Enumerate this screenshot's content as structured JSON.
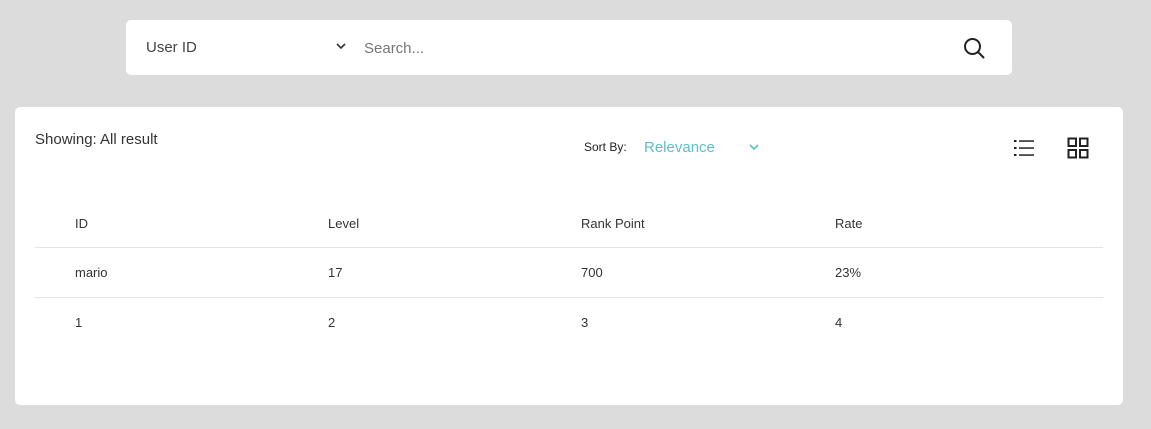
{
  "search": {
    "filter_label": "User ID",
    "placeholder": "Search...",
    "value": ""
  },
  "results": {
    "showing_label": "Showing: All result",
    "sort_label": "Sort By:",
    "sort_value": "Relevance",
    "columns": [
      "ID",
      "Level",
      "Rank Point",
      "Rate"
    ],
    "rows": [
      [
        "mario",
        "17",
        "700",
        "23%"
      ],
      [
        "1",
        "2",
        "3",
        "4"
      ]
    ]
  },
  "colors": {
    "background": "#dcdcdc",
    "accent": "#5bc0c9",
    "card": "#ffffff"
  },
  "icons": {
    "filter_chevron": "chevron-down-icon",
    "search": "search-icon",
    "sort_chevron": "chevron-down-icon",
    "list_view": "list-view-icon",
    "grid_view": "grid-view-icon"
  }
}
